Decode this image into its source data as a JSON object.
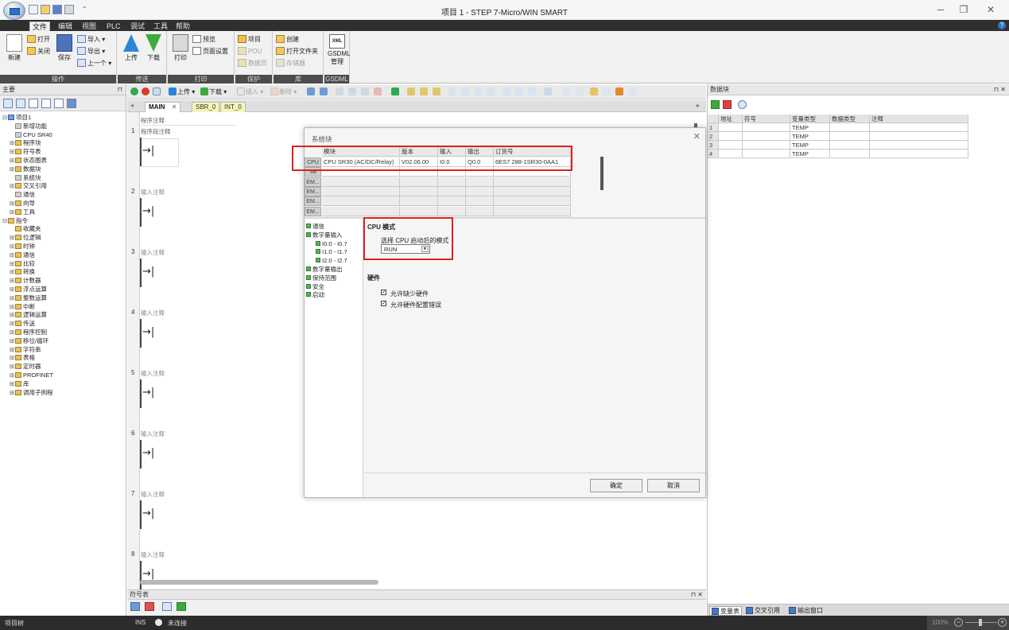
{
  "window": {
    "title": "项目 1 - STEP 7-Micro/WIN SMART",
    "minimize": "─",
    "maximize": "❐",
    "close": "✕",
    "quick_access_more": "⁼"
  },
  "ribbon_tabs": [
    "文件",
    "编辑",
    "视图",
    "PLC",
    "调试",
    "工具",
    "帮助"
  ],
  "ribbon": {
    "operation": {
      "group": "操作",
      "new": "新建",
      "open": "打开",
      "close": "关闭",
      "save": "保存",
      "import": "导入 ▾",
      "export": "导出 ▾",
      "previous": "上一个 ▾"
    },
    "transfer": {
      "group": "传送",
      "upload": "上传",
      "download": "下载"
    },
    "print": {
      "group": "打印",
      "print": "打印",
      "preview": "预览",
      "page_setup": "页面设置"
    },
    "protect": {
      "group": "保护",
      "project": "项目",
      "pou": "POU",
      "data_page": "数据页"
    },
    "library": {
      "group": "库",
      "create": "创建",
      "open_folder": "打开文件夹",
      "memory": "存储器"
    },
    "gsdml": {
      "group": "GSDML",
      "label": "GSDML 管理",
      "xml": "XML"
    }
  },
  "left_panel": {
    "title": "主要",
    "pin": "⊓",
    "tree": [
      {
        "toggle": "⊟",
        "label": "项目1",
        "level": 0,
        "icon": "blue"
      },
      {
        "toggle": "",
        "label": "新增功能",
        "level": 1,
        "icon": "gray"
      },
      {
        "toggle": "",
        "label": "CPU SR40",
        "level": 1,
        "icon": "gray"
      },
      {
        "toggle": "⊞",
        "label": "程序块",
        "level": 1,
        "icon": "folder"
      },
      {
        "toggle": "⊞",
        "label": "符号表",
        "level": 1,
        "icon": "folder"
      },
      {
        "toggle": "⊞",
        "label": "状态图表",
        "level": 1,
        "icon": "folder"
      },
      {
        "toggle": "⊞",
        "label": "数据块",
        "level": 1,
        "icon": "folder"
      },
      {
        "toggle": "",
        "label": "系统块",
        "level": 1,
        "icon": "gray"
      },
      {
        "toggle": "⊞",
        "label": "交叉引用",
        "level": 1,
        "icon": "folder"
      },
      {
        "toggle": "",
        "label": "通信",
        "level": 1,
        "icon": "gray"
      },
      {
        "toggle": "⊞",
        "label": "向导",
        "level": 1,
        "icon": "folder"
      },
      {
        "toggle": "⊞",
        "label": "工具",
        "level": 1,
        "icon": "folder"
      },
      {
        "toggle": "⊟",
        "label": "指令",
        "level": 0,
        "icon": "folder"
      },
      {
        "toggle": "",
        "label": "收藏夹",
        "level": 1,
        "icon": "folder"
      },
      {
        "toggle": "⊞",
        "label": "位逻辑",
        "level": 1,
        "icon": "folder"
      },
      {
        "toggle": "⊞",
        "label": "时钟",
        "level": 1,
        "icon": "folder"
      },
      {
        "toggle": "⊞",
        "label": "通信",
        "level": 1,
        "icon": "folder"
      },
      {
        "toggle": "⊞",
        "label": "比较",
        "level": 1,
        "icon": "folder"
      },
      {
        "toggle": "⊞",
        "label": "转换",
        "level": 1,
        "icon": "folder"
      },
      {
        "toggle": "⊞",
        "label": "计数器",
        "level": 1,
        "icon": "folder"
      },
      {
        "toggle": "⊞",
        "label": "浮点运算",
        "level": 1,
        "icon": "folder"
      },
      {
        "toggle": "⊞",
        "label": "整数运算",
        "level": 1,
        "icon": "folder"
      },
      {
        "toggle": "⊞",
        "label": "中断",
        "level": 1,
        "icon": "folder"
      },
      {
        "toggle": "⊞",
        "label": "逻辑运算",
        "level": 1,
        "icon": "folder"
      },
      {
        "toggle": "⊞",
        "label": "传送",
        "level": 1,
        "icon": "folder"
      },
      {
        "toggle": "⊞",
        "label": "程序控制",
        "level": 1,
        "icon": "folder"
      },
      {
        "toggle": "⊞",
        "label": "移位/循环",
        "level": 1,
        "icon": "folder"
      },
      {
        "toggle": "⊞",
        "label": "字符串",
        "level": 1,
        "icon": "folder"
      },
      {
        "toggle": "⊞",
        "label": "表格",
        "level": 1,
        "icon": "folder"
      },
      {
        "toggle": "⊞",
        "label": "定时器",
        "level": 1,
        "icon": "folder"
      },
      {
        "toggle": "⊞",
        "label": "PROFINET",
        "level": 1,
        "icon": "folder"
      },
      {
        "toggle": "⊞",
        "label": "库",
        "level": 1,
        "icon": "folder"
      },
      {
        "toggle": "⊞",
        "label": "调用子例程",
        "level": 1,
        "icon": "folder"
      }
    ]
  },
  "editor_toolbar": {
    "upload": "上传 ▾",
    "download": "下载 ▾",
    "insert": "插入 ▾",
    "delete": "删除 ▾"
  },
  "editor_tabs": [
    {
      "label": "MAIN",
      "close": "✕"
    },
    {
      "label": "SBR_0"
    },
    {
      "label": "INT_0"
    }
  ],
  "program": {
    "comment": "程序注释",
    "first_network_title": "程序段注释",
    "network_title": "输入注释",
    "coil_glyph": "→|",
    "networks": [
      "1",
      "2",
      "3",
      "4",
      "5",
      "6",
      "7",
      "8"
    ]
  },
  "dialog": {
    "title": "系统块",
    "close": "✕",
    "table_headers": [
      "模块",
      "版本",
      "输入",
      "输出",
      "订货号"
    ],
    "rows": [
      {
        "label": "CPU",
        "module": "CPU SR30 (AC/DC/Relay)",
        "version": "V02.06.00",
        "input": "I0.0",
        "output": "Q0.0",
        "order": "6ES7 288-1SR30-0AA1"
      },
      {
        "label": "SB",
        "module": "",
        "version": "",
        "input": "",
        "output": "",
        "order": ""
      },
      {
        "label": "EM...",
        "module": "",
        "version": "",
        "input": "",
        "output": "",
        "order": ""
      },
      {
        "label": "EM...",
        "module": "",
        "version": "",
        "input": "",
        "output": "",
        "order": ""
      },
      {
        "label": "EM...",
        "module": "",
        "version": "",
        "input": "",
        "output": "",
        "order": ""
      },
      {
        "label": "EM...",
        "module": "",
        "version": "",
        "input": "",
        "output": "",
        "order": ""
      }
    ],
    "nav": [
      "通信",
      "数字量输入",
      "I0.0 - I0.7",
      "I1.0 - I1.7",
      "I2.0 - I2.7",
      "数字量输出",
      "保持范围",
      "安全",
      "启动"
    ],
    "cpu_mode": {
      "heading": "CPU 模式",
      "prompt": "选择 CPU 启动后的模式",
      "value": "RUN"
    },
    "hardware": {
      "heading": "硬件",
      "allow_missing": "允许缺少硬件",
      "allow_config_error": "允许硬件配置错误"
    },
    "ok": "确定",
    "cancel": "取消"
  },
  "right_panel": {
    "title": "数据块",
    "pin": "⊓ ✕",
    "headers": [
      "地址",
      "符号",
      "变量类型",
      "数据类型",
      "注释"
    ],
    "rows": [
      {
        "no": "1",
        "type": "TEMP"
      },
      {
        "no": "2",
        "type": "TEMP"
      },
      {
        "no": "3",
        "type": "TEMP"
      },
      {
        "no": "4",
        "type": "TEMP"
      }
    ],
    "bottom_tabs": [
      "变量表",
      "交叉引用",
      "输出窗口"
    ]
  },
  "symbol_panel": {
    "title": "符号表",
    "pin": "⊓ ✕"
  },
  "status": {
    "left": "项目树",
    "mode": "INS",
    "connection": "未连接",
    "zoom": "100%",
    "minus": "−",
    "plus": "+"
  },
  "colors": {
    "highlight": "#e02020",
    "ribbon_tab_bar": "#2f2f2f",
    "status_bar": "#2c2c2c"
  }
}
